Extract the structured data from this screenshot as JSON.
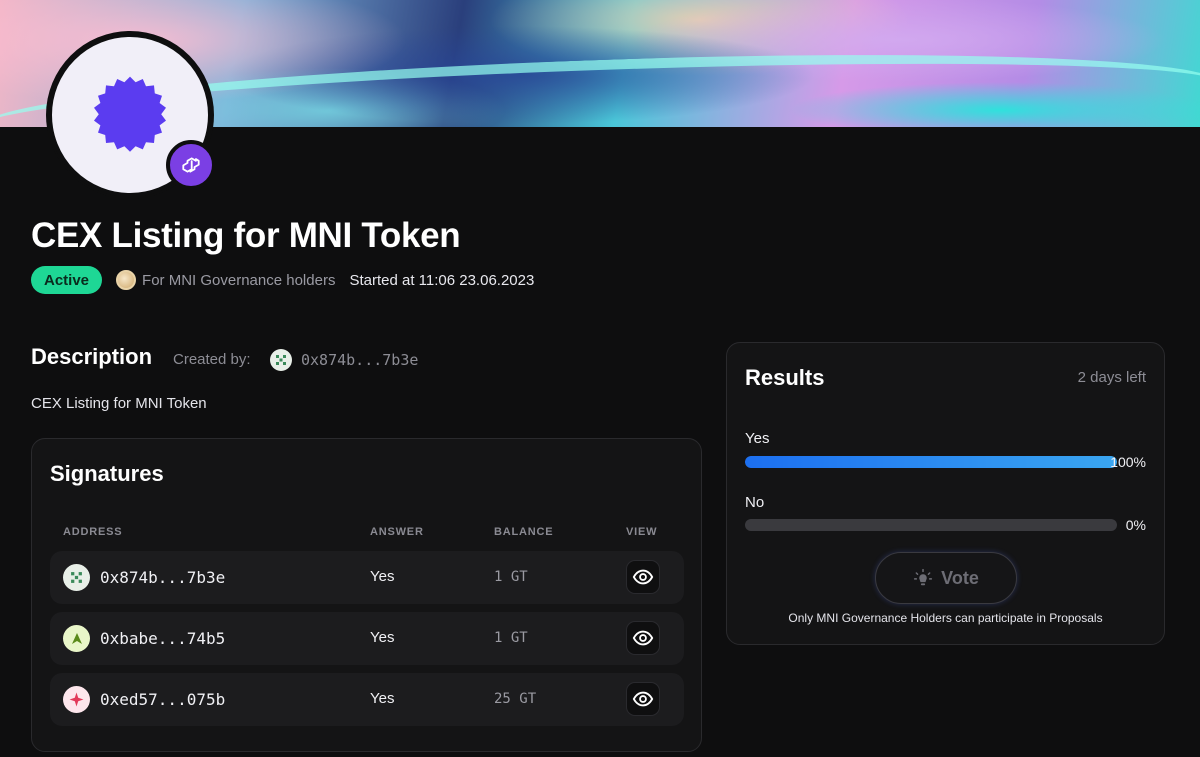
{
  "proposal": {
    "title": "CEX Listing for MNI Token",
    "status": "Active",
    "audience": "For MNI Governance holders",
    "started": "Started at 11:06 23.06.2023",
    "avatar_icon": "badge-icon",
    "chain_icon": "polygon-icon"
  },
  "description": {
    "heading": "Description",
    "created_by_label": "Created by:",
    "creator_address": "0x874b...7b3e",
    "text": "CEX Listing for MNI Token"
  },
  "signatures": {
    "heading": "Signatures",
    "columns": [
      "ADDRESS",
      "ANSWER",
      "BALANCE",
      "VIEW"
    ],
    "rows": [
      {
        "address": "0x874b...7b3e",
        "answer": "Yes",
        "balance": "1 GT",
        "icon_color": "#e8efe8"
      },
      {
        "address": "0xbabe...74b5",
        "answer": "Yes",
        "balance": "1 GT",
        "icon_color": "#e9f6c9"
      },
      {
        "address": "0xed57...075b",
        "answer": "Yes",
        "balance": "25 GT",
        "icon_color": "#fde6ec"
      }
    ]
  },
  "results": {
    "heading": "Results",
    "time_left": "2 days left",
    "options": [
      {
        "label": "Yes",
        "percent_text": "100%",
        "fraction": 1.0
      },
      {
        "label": "No",
        "percent_text": "0%",
        "fraction": 0.0
      }
    ],
    "vote_label": "Vote",
    "vote_note": "Only MNI Governance Holders can participate in Proposals"
  },
  "colors": {
    "active_badge": "#1ed795",
    "bar_fill": "#1c6ff0",
    "polygon": "#7b3fe4",
    "avatar_badge": "#5b3cf0"
  }
}
